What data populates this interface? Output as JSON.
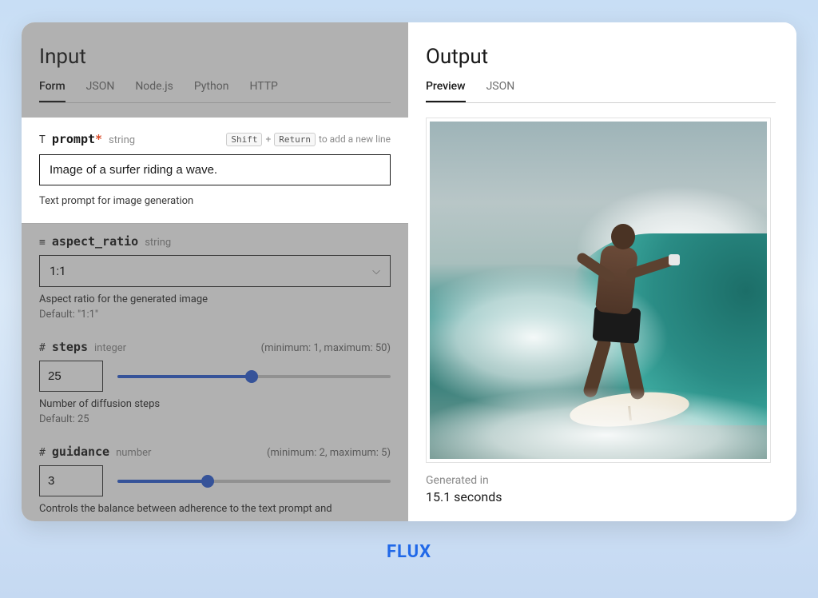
{
  "brand": "FLUX",
  "input": {
    "title": "Input",
    "tabs": [
      "Form",
      "JSON",
      "Node.js",
      "Python",
      "HTTP"
    ],
    "active_tab": "Form",
    "prompt": {
      "icon": "T",
      "name": "prompt",
      "required": "*",
      "type": "string",
      "hint_key1": "Shift",
      "hint_plus": "+",
      "hint_key2": "Return",
      "hint_tail": "to add a new line",
      "value": "Image of a surfer riding a wave.",
      "description": "Text prompt for image generation"
    },
    "aspect_ratio": {
      "icon": "≡",
      "name": "aspect_ratio",
      "type": "string",
      "value": "1:1",
      "description": "Aspect ratio for the generated image",
      "default": "Default: \"1:1\""
    },
    "steps": {
      "icon": "#",
      "name": "steps",
      "type": "integer",
      "minmax": "(minimum: 1, maximum: 50)",
      "value": "25",
      "fill_pct": 49,
      "description": "Number of diffusion steps",
      "default": "Default: 25"
    },
    "guidance": {
      "icon": "#",
      "name": "guidance",
      "type": "number",
      "minmax": "(minimum: 2, maximum: 5)",
      "value": "3",
      "fill_pct": 33,
      "description": "Controls the balance between adherence to the text prompt and"
    }
  },
  "output": {
    "title": "Output",
    "tabs": [
      "Preview",
      "JSON"
    ],
    "active_tab": "Preview",
    "gen_label": "Generated in",
    "gen_time": "15.1 seconds"
  }
}
